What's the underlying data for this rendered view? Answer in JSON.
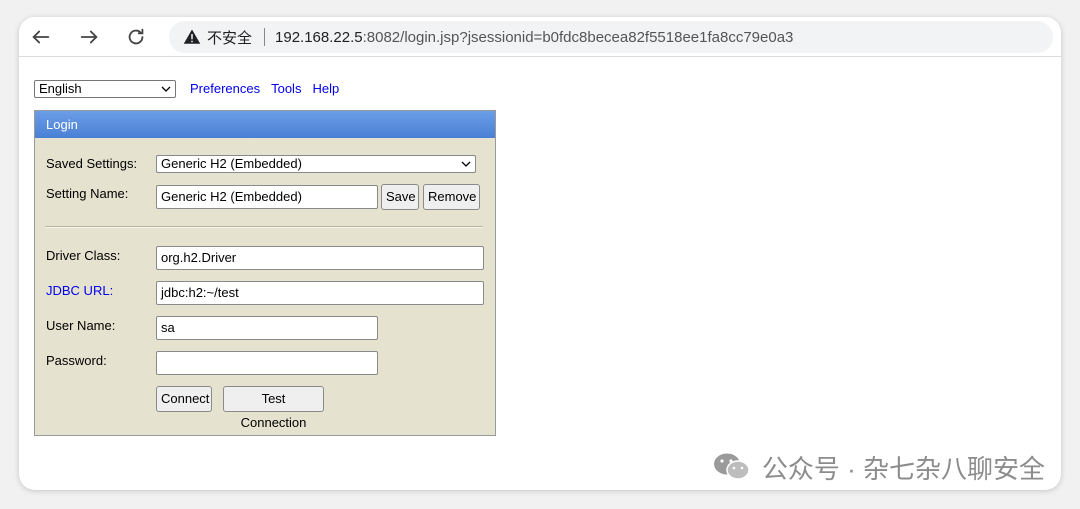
{
  "browser": {
    "security_label": "不安全",
    "url_host": "192.168.22.5",
    "url_rest": ":8082/login.jsp?jsessionid=b0fdc8becea82f5518ee1fa8cc79e0a3"
  },
  "topbar": {
    "language": "English",
    "links": [
      "Preferences",
      "Tools",
      "Help"
    ]
  },
  "login": {
    "title": "Login",
    "saved_settings_label": "Saved Settings:",
    "saved_settings_value": "Generic H2 (Embedded)",
    "setting_name_label": "Setting Name:",
    "setting_name_value": "Generic H2 (Embedded)",
    "save_label": "Save",
    "remove_label": "Remove",
    "driver_class_label": "Driver Class:",
    "driver_class_value": "org.h2.Driver",
    "jdbc_url_label": "JDBC URL:",
    "jdbc_url_value": "jdbc:h2:~/test",
    "user_name_label": "User Name:",
    "user_name_value": "sa",
    "password_label": "Password:",
    "password_value": "",
    "connect_label": "Connect",
    "test_connection_label": "Test Connection"
  },
  "watermark": {
    "text": "公众号 · 杂七杂八聊安全"
  },
  "icons": {
    "back": "arrow-left-icon",
    "forward": "arrow-right-icon",
    "reload": "reload-icon",
    "warning": "warning-triangle-icon",
    "dropdown": "chevron-down-icon",
    "wechat": "wechat-icon"
  },
  "colors": {
    "panel_bg": "#e5e2cf",
    "header_blue": "#4a80d4",
    "link_blue": "#0000ee"
  }
}
